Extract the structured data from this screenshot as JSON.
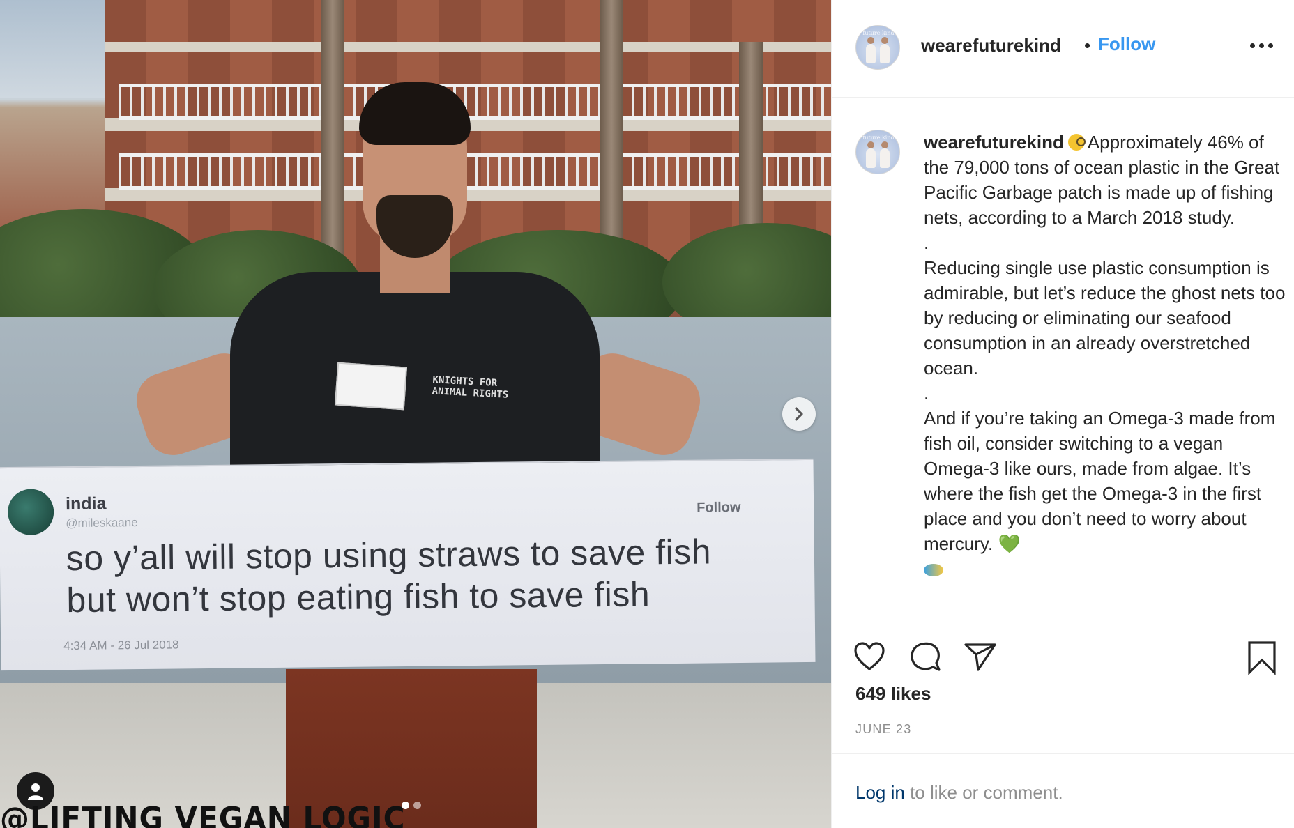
{
  "post": {
    "image": {
      "banner_name": "india",
      "banner_handle": "@mileskaane",
      "banner_follow": "Follow",
      "banner_line1": "so y’all will stop using straws to save fish",
      "banner_line2": "but won’t stop eating fish to save fish",
      "banner_time": "4:34 AM - 26 Jul 2018",
      "shirt_line1": "KNIGHTS FOR",
      "shirt_line2": "ANIMAL RIGHTS",
      "watermark": "@LIFTING VEGAN LOGIC",
      "carousel_count": 2,
      "carousel_active": 1
    }
  },
  "header": {
    "username": "wearefuturekind",
    "separator": "•",
    "follow_label": "Follow",
    "avatar_text": "future kind"
  },
  "caption": {
    "username": "wearefuturekind",
    "p1": "Approximately 46% of the 79,000 tons of ocean plastic in the Great Pacific Garbage patch is made up of fishing nets, according to a March 2018 study.",
    "sep1": ".",
    "p2": "Reducing single use plastic consumption is admirable, but let’s reduce the ghost nets too by reducing or eliminating our seafood consumption in an already overstretched ocean.",
    "sep2": ".",
    "p3": "And if you’re taking an Omega-3 made from fish oil, consider switching to a vegan Omega-3 like ours, made from algae. It’s where the fish get the Omega-3 in the first place and you don’t need to worry about mercury.",
    "emoji_heart": "💚"
  },
  "stats": {
    "likes": "649 likes",
    "date": "JUNE 23"
  },
  "footer": {
    "login_link": "Log in",
    "login_rest": " to like or comment."
  },
  "icons": [
    "like-icon",
    "comment-icon",
    "share-icon",
    "save-icon",
    "more-options-icon",
    "user-tag-icon",
    "chevron-right-icon"
  ],
  "colors": {
    "link_blue": "#3897f0",
    "text": "#262626",
    "muted": "#8e8e8e",
    "login_link": "#00376b"
  }
}
